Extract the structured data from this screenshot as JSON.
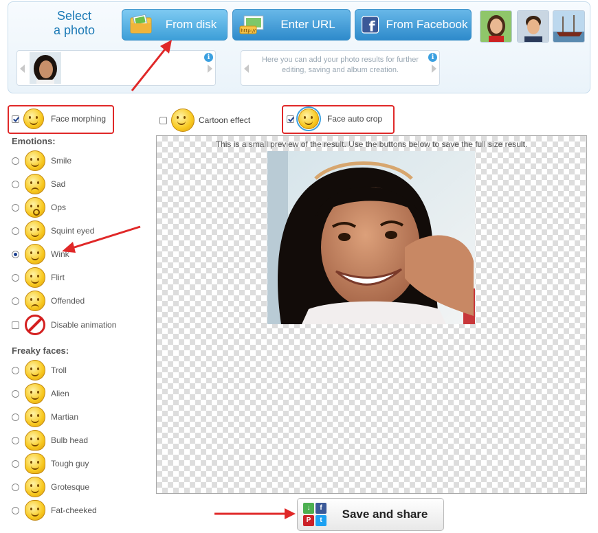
{
  "header": {
    "select_title_line1": "Select",
    "select_title_line2": "a photo",
    "from_disk_label": "From disk",
    "enter_url_label": "Enter URL",
    "facebook_label": "From Facebook",
    "url_icon_text": "http://",
    "facebook_icon_text": "f",
    "info_glyph": "i",
    "results_hint": "Here you can add your photo results for further editing, saving and album creation."
  },
  "effects": {
    "face_morphing": {
      "label": "Face morphing",
      "checked": true
    },
    "cartoon_effect": {
      "label": "Cartoon effect",
      "checked": false
    },
    "face_auto_crop": {
      "label": "Face auto crop",
      "checked": true
    }
  },
  "emotions": {
    "heading": "Emotions:",
    "items": [
      {
        "label": "Smile",
        "selected": false
      },
      {
        "label": "Sad",
        "selected": false
      },
      {
        "label": "Ops",
        "selected": false
      },
      {
        "label": "Squint eyed",
        "selected": false
      },
      {
        "label": "Wink",
        "selected": true
      },
      {
        "label": "Flirt",
        "selected": false
      },
      {
        "label": "Offended",
        "selected": false
      }
    ],
    "disable_animation": {
      "label": "Disable animation",
      "checked": false
    }
  },
  "freaky": {
    "heading": "Freaky faces:",
    "items": [
      {
        "label": "Troll"
      },
      {
        "label": "Alien"
      },
      {
        "label": "Martian"
      },
      {
        "label": "Bulb head"
      },
      {
        "label": "Tough guy"
      },
      {
        "label": "Grotesque"
      },
      {
        "label": "Fat-cheeked"
      }
    ]
  },
  "preview": {
    "caption": "This is a small preview of the result. Use the buttons below to save the full size result."
  },
  "save": {
    "label": "Save and share",
    "share_icons": [
      "download-icon",
      "facebook-icon",
      "pinterest-icon",
      "twitter-icon"
    ],
    "share_glyphs": {
      "download": "↓",
      "facebook": "f",
      "pinterest": "P",
      "twitter": "t"
    }
  },
  "colors": {
    "accent_blue": "#3d9fd8",
    "facebook_blue": "#3b5998",
    "annotation_red": "#e02828",
    "face_yellow": "#f8c81e"
  }
}
